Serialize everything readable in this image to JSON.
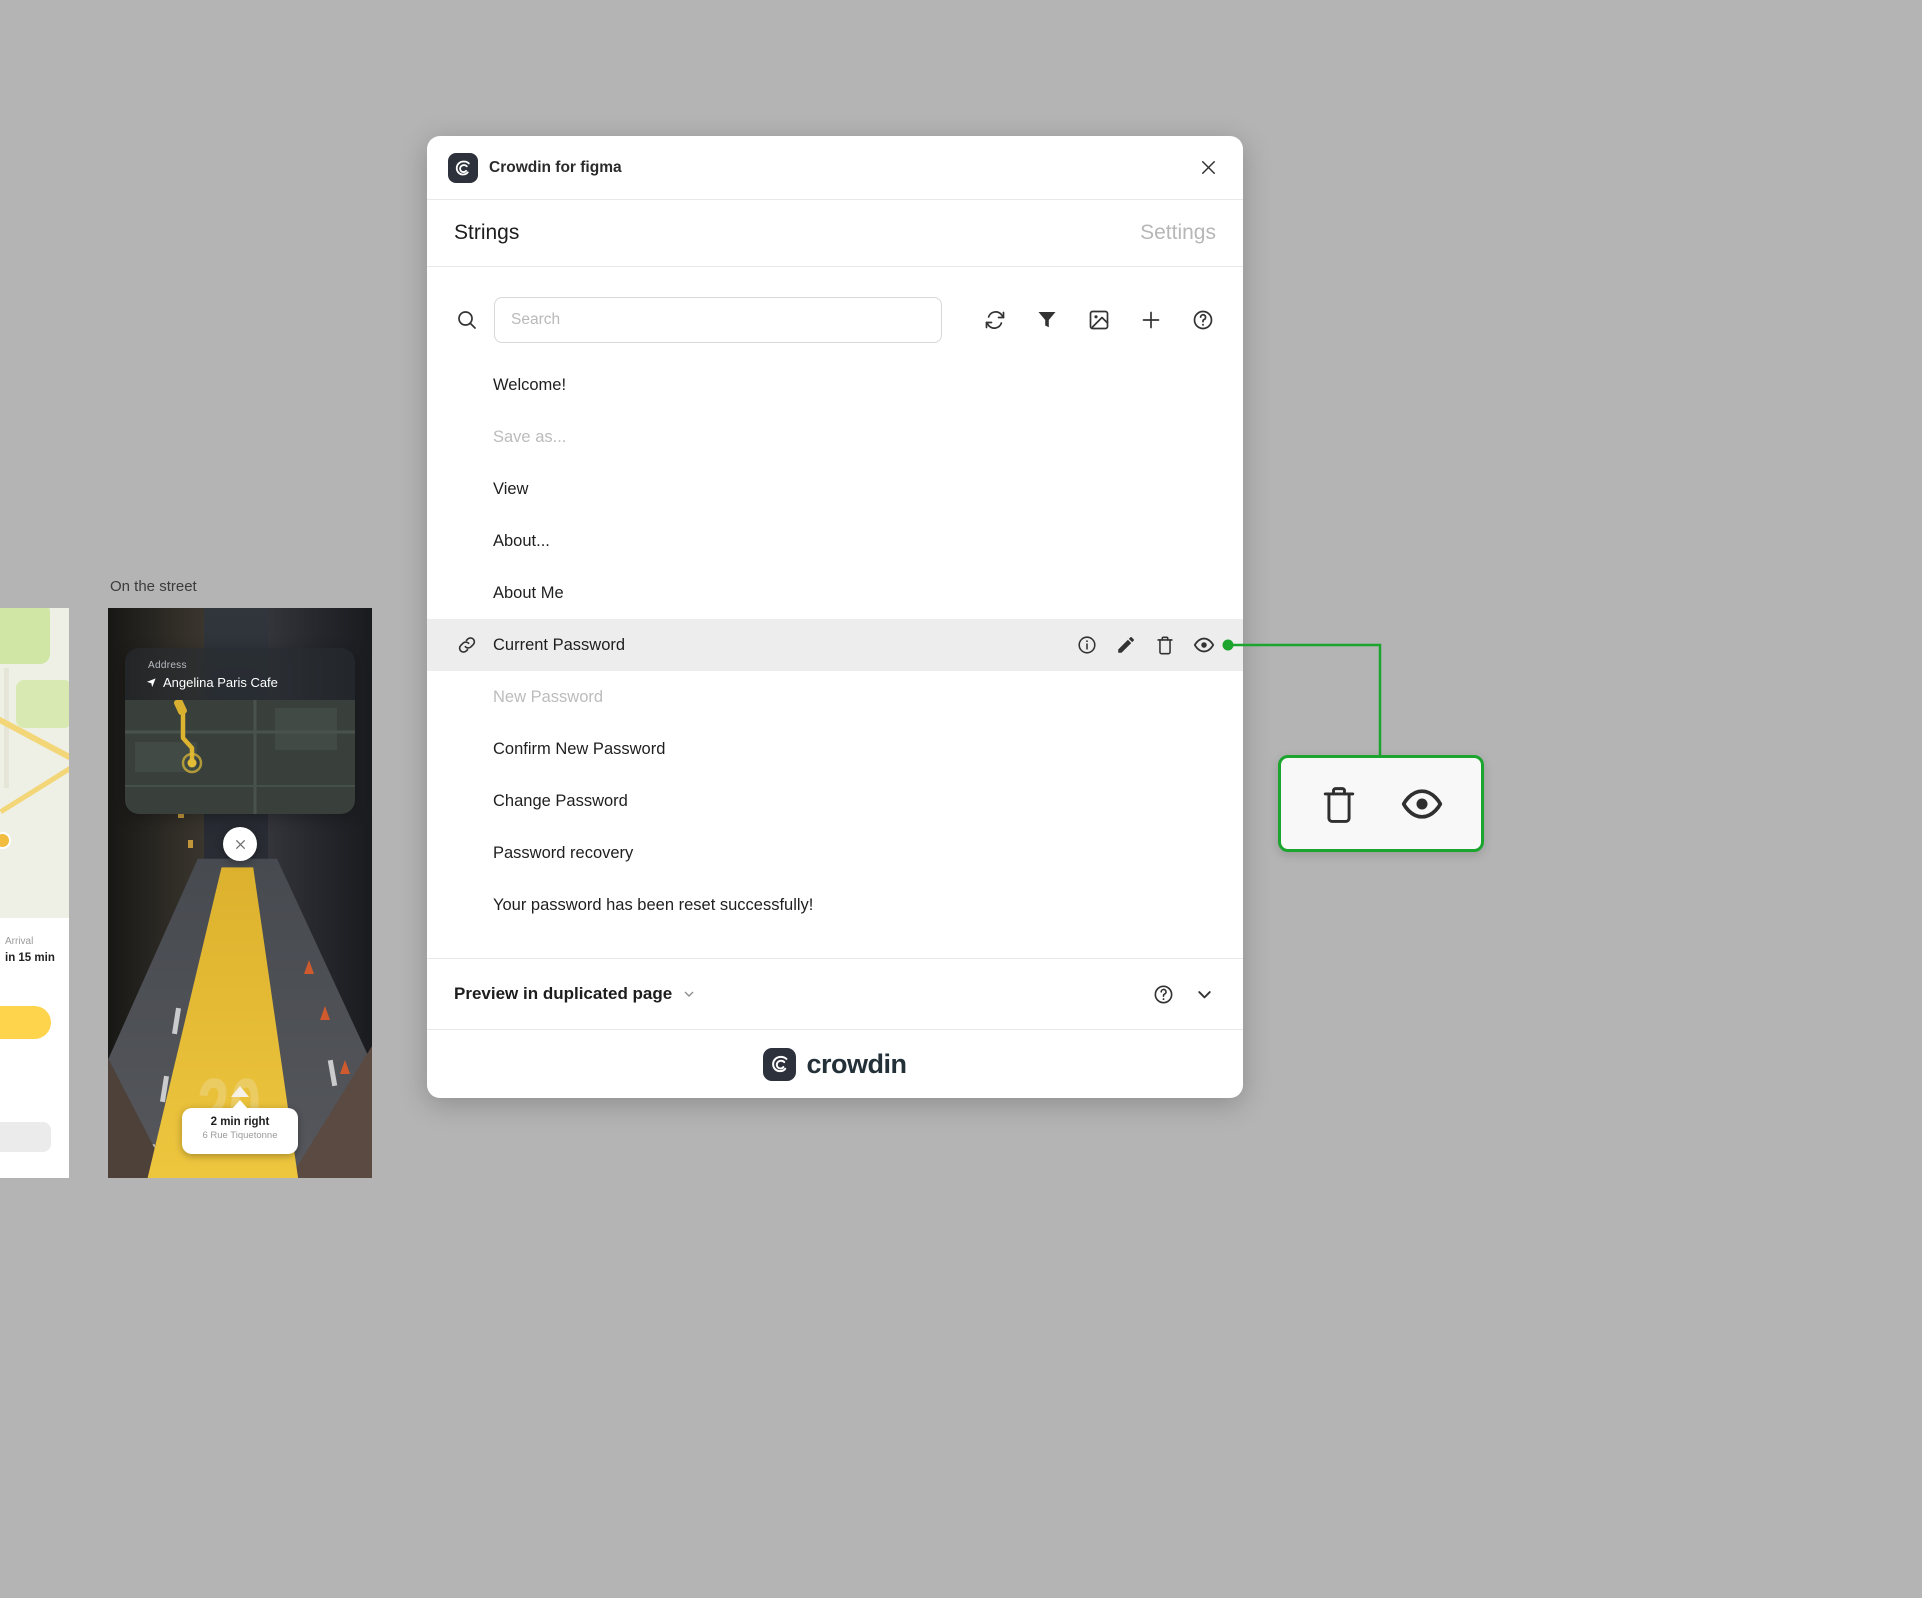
{
  "canvas": {
    "frame_label": "On the street"
  },
  "plugin": {
    "title": "Crowdin for figma",
    "tabs": {
      "strings": "Strings",
      "settings": "Settings"
    },
    "search": {
      "placeholder": "Search"
    },
    "strings": [
      {
        "label": "Welcome!"
      },
      {
        "label": "Save as...",
        "muted": true
      },
      {
        "label": "View"
      },
      {
        "label": "About..."
      },
      {
        "label": "About Me"
      },
      {
        "label": "Current Password",
        "selected": true
      },
      {
        "label": "New Password",
        "muted": true
      },
      {
        "label": "Confirm New Password"
      },
      {
        "label": "Change Password"
      },
      {
        "label": "Password recovery"
      },
      {
        "label": "Your password has been reset successfully!"
      }
    ],
    "preview": {
      "label": "Preview in duplicated page"
    },
    "brand": "crowdin"
  },
  "phone": {
    "address_label": "Address",
    "address_value": "Angelina Paris Cafe",
    "path_number": "20",
    "direction_title": "2 min right",
    "direction_subtitle": "6 Rue Tiquetonne"
  },
  "left_frame": {
    "arrival_label": "Arrival",
    "arrival_time": "in 15 min"
  },
  "icons": {
    "toolbar": [
      "search-icon",
      "refresh-icon",
      "filter-icon",
      "image-icon",
      "plus-icon",
      "help-icon"
    ],
    "row_actions": [
      "info-icon",
      "edit-icon",
      "delete-icon",
      "eye-icon"
    ],
    "callout": [
      "delete-icon",
      "eye-icon"
    ]
  },
  "colors": {
    "accent_green": "#1ca52e",
    "selected_row_bg": "#ededed",
    "canvas_bg": "#b4b4b4"
  }
}
